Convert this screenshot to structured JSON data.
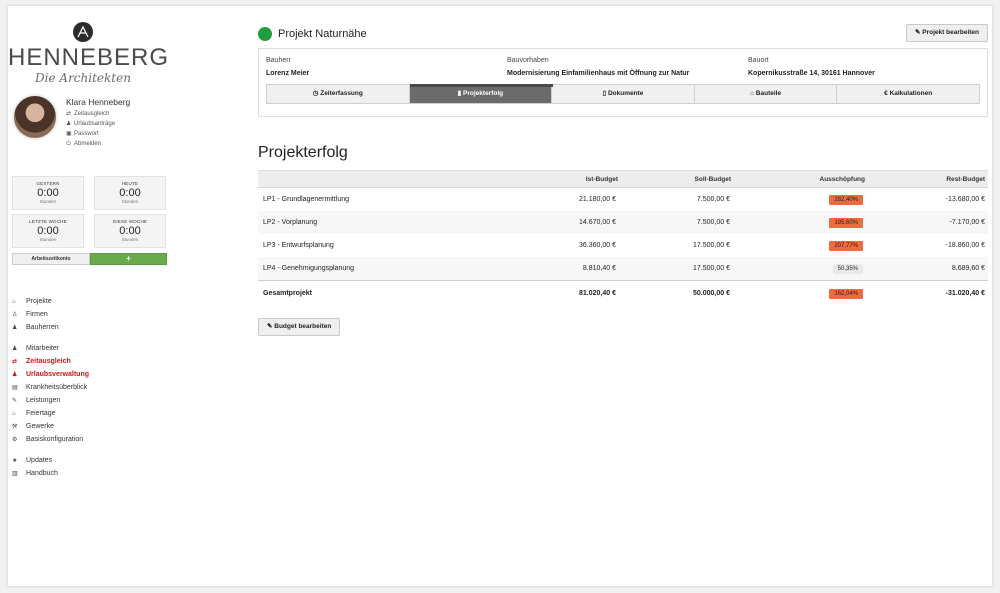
{
  "brand": {
    "name": "HENNEBERG",
    "subtitle": "Die Architekten"
  },
  "profile": {
    "name": "Klara Henneberg",
    "links": [
      {
        "label": "Zeitausgleich",
        "icon": "swap-icon"
      },
      {
        "label": "Urlaubsanträge",
        "icon": "people-icon"
      },
      {
        "label": "Passwort",
        "icon": "lock-icon"
      },
      {
        "label": "Abmelden",
        "icon": "power-icon"
      }
    ]
  },
  "stats": {
    "gestern": {
      "label": "GESTERN",
      "value": "0:00",
      "unit": "Stunden"
    },
    "heute": {
      "label": "HEUTE",
      "value": "0:00",
      "unit": "Stunden"
    },
    "letzte_woche": {
      "label": "LETZTE WOCHE",
      "value": "0:00",
      "unit": "Stunden"
    },
    "diese_woche": {
      "label": "DIESE WOCHE",
      "value": "0:00",
      "unit": "Stunden"
    },
    "konto_label": "Arbeitszeitkonto",
    "plus_label": "+"
  },
  "nav": {
    "items": [
      {
        "label": "Projekte",
        "icon": "home-icon",
        "active": false
      },
      {
        "label": "Firmen",
        "icon": "user-icon",
        "active": false
      },
      {
        "label": "Bauherren",
        "icon": "users-icon",
        "active": false
      },
      {
        "label": "Mitarbeiter",
        "icon": "team-icon",
        "active": false
      },
      {
        "label": "Zeitausgleich",
        "icon": "swap-icon",
        "active": true
      },
      {
        "label": "Urlaubsverwaltung",
        "icon": "people-icon",
        "active": true
      },
      {
        "label": "Krankheitsüberblick",
        "icon": "medkit-icon",
        "active": false
      },
      {
        "label": "Leistungen",
        "icon": "wrench-icon",
        "active": false
      },
      {
        "label": "Feiertage",
        "icon": "home-icon",
        "active": false
      },
      {
        "label": "Gewerke",
        "icon": "trades-icon",
        "active": false
      },
      {
        "label": "Basiskonfiguration",
        "icon": "gear-icon",
        "active": false
      },
      {
        "label": "Updates",
        "icon": "star-icon",
        "active": false
      },
      {
        "label": "Handbuch",
        "icon": "book-icon",
        "active": false
      }
    ]
  },
  "project": {
    "title": "Projekt Naturnähe",
    "status_color": "#1f9d3c",
    "edit_label": "Projekt bearbeiten",
    "bauherr_label": "Bauherr",
    "bauherr_value": "Lorenz Meier",
    "bauvorhaben_label": "Bauvorhaben",
    "bauvorhaben_value": "Modernisierung Einfamilienhaus mit Öffnung zur Natur",
    "bauort_label": "Bauort",
    "bauort_value": "Kopernikusstraße 14, 30161 Hannover"
  },
  "tabs": [
    {
      "label": "Zeiterfassung",
      "icon": "clock-icon",
      "active": false
    },
    {
      "label": "Projekterfolg",
      "icon": "bar-chart-icon",
      "active": true
    },
    {
      "label": "Dokumente",
      "icon": "document-icon",
      "active": false
    },
    {
      "label": "Bauteile",
      "icon": "home-icon",
      "active": false
    },
    {
      "label": "Kalkulationen",
      "icon": "euro-icon",
      "active": false
    }
  ],
  "section": {
    "title": "Projekterfolg",
    "budget_button": "Budget bearbeiten"
  },
  "table": {
    "headers": {
      "ist": "Ist-Budget",
      "soll": "Soll-Budget",
      "aus": "Ausschöpfung",
      "rest": "Rest-Budget"
    },
    "rows": [
      {
        "name": "LP1 - Grundlagenermittlung",
        "ist": "21.180,00 €",
        "soll": "7.500,00 €",
        "aus": "282,40%",
        "over": true,
        "rest": "-13.680,00 €"
      },
      {
        "name": "LP2 - Vorplanung",
        "ist": "14.670,00 €",
        "soll": "7.500,00 €",
        "aus": "195,60%",
        "over": true,
        "rest": "-7.170,00 €"
      },
      {
        "name": "LP3 - Entwurfsplanung",
        "ist": "36.360,00 €",
        "soll": "17.500,00 €",
        "aus": "207,77%",
        "over": true,
        "rest": "-18.860,00 €"
      },
      {
        "name": "LP4 - Genehmigungsplanung",
        "ist": "8.810,40 €",
        "soll": "17.500,00 €",
        "aus": "50,35%",
        "over": false,
        "rest": "8.689,60 €"
      }
    ],
    "total": {
      "name": "Gesamtprojekt",
      "ist": "81.020,40 €",
      "soll": "50.000,00 €",
      "aus": "162,04%",
      "over": true,
      "rest": "-31.020,40 €"
    }
  },
  "colors": {
    "over_budget": "#f06a3c",
    "active_nav": "#d01818",
    "active_tab": "#6b6b6b",
    "plus_button": "#6aaa4a"
  }
}
